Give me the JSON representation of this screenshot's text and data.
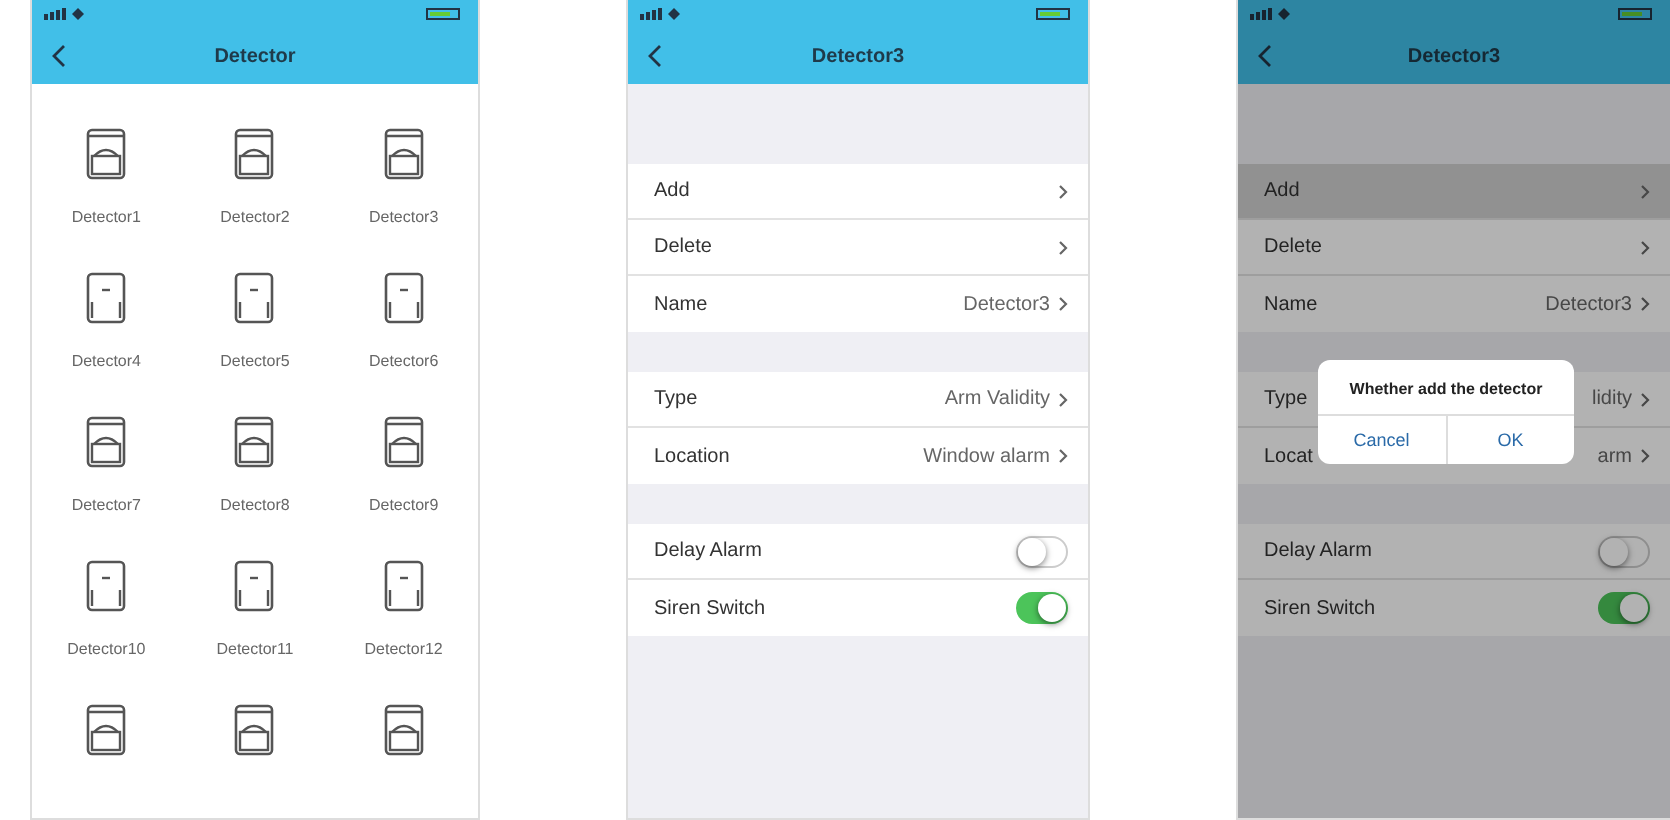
{
  "screens": [
    {
      "kind": "grid",
      "title": "Detector",
      "items": [
        {
          "label": "Detector1",
          "kind": "window"
        },
        {
          "label": "Detector2",
          "kind": "window"
        },
        {
          "label": "Detector3",
          "kind": "window"
        },
        {
          "label": "Detector4",
          "kind": "door"
        },
        {
          "label": "Detector5",
          "kind": "door"
        },
        {
          "label": "Detector6",
          "kind": "door"
        },
        {
          "label": "Detector7",
          "kind": "window"
        },
        {
          "label": "Detector8",
          "kind": "window"
        },
        {
          "label": "Detector9",
          "kind": "window"
        },
        {
          "label": "Detector10",
          "kind": "door"
        },
        {
          "label": "Detector11",
          "kind": "door"
        },
        {
          "label": "Detector12",
          "kind": "door"
        },
        {
          "kind": "window"
        },
        {
          "kind": "window"
        },
        {
          "kind": "window"
        }
      ]
    },
    {
      "kind": "settings",
      "title": "Detector3",
      "groups": [
        [
          {
            "kind": "link",
            "label": "Add",
            "selected": false
          },
          {
            "kind": "link",
            "label": "Delete",
            "selected": false
          },
          {
            "kind": "link",
            "label": "Name",
            "value": "Detector3",
            "selected": false
          }
        ],
        [
          {
            "kind": "link",
            "label": "Type",
            "value": "Arm Validity",
            "selected": false
          },
          {
            "kind": "link",
            "label": "Location",
            "value": "Window alarm",
            "selected": false
          }
        ],
        [
          {
            "kind": "toggle",
            "label": "Delay Alarm",
            "on": false
          },
          {
            "kind": "toggle",
            "label": "Siren Switch",
            "on": true
          }
        ]
      ]
    },
    {
      "kind": "settings",
      "title": "Detector3",
      "groups": [
        [
          {
            "kind": "link",
            "label": "Add",
            "selected": true
          },
          {
            "kind": "link",
            "label": "Delete",
            "selected": false
          },
          {
            "kind": "link",
            "label": "Name",
            "value": "Detector3",
            "selected": false
          }
        ],
        [
          {
            "kind": "link",
            "label": "Type",
            "value": "lidity",
            "selected": false
          },
          {
            "kind": "link",
            "label": "Locat",
            "value": "arm",
            "selected": false
          }
        ],
        [
          {
            "kind": "toggle",
            "label": "Delay Alarm",
            "on": false
          },
          {
            "kind": "toggle",
            "label": "Siren Switch",
            "on": true
          }
        ]
      ],
      "dialog": {
        "message": "Whether add the detector",
        "buttons": [
          "Cancel",
          "OK"
        ]
      }
    }
  ]
}
